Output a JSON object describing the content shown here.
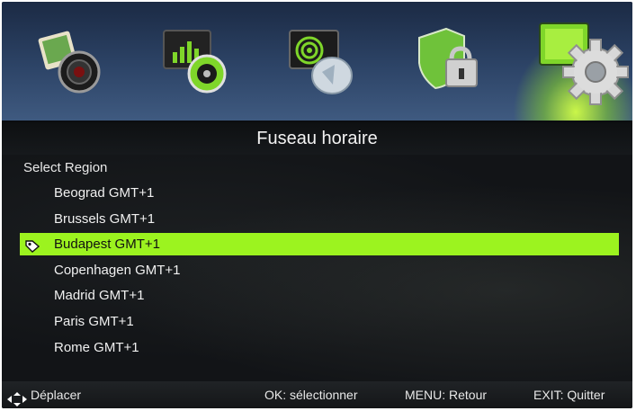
{
  "header": {
    "icons": [
      {
        "name": "picture-camera-icon"
      },
      {
        "name": "media-player-icon"
      },
      {
        "name": "satellite-dish-icon"
      },
      {
        "name": "security-lock-icon"
      },
      {
        "name": "settings-gear-icon"
      }
    ],
    "active_icon": "settings-gear-icon",
    "accent_color": "#9cf31f"
  },
  "title": "Fuseau horaire",
  "region_label": "Select Region",
  "regions": [
    {
      "label": "Beograd GMT+1",
      "selected": false
    },
    {
      "label": "Brussels GMT+1",
      "selected": false
    },
    {
      "label": "Budapest GMT+1",
      "selected": true
    },
    {
      "label": "Copenhagen GMT+1",
      "selected": false
    },
    {
      "label": "Madrid GMT+1",
      "selected": false
    },
    {
      "label": "Paris GMT+1",
      "selected": false
    },
    {
      "label": "Rome GMT+1",
      "selected": false
    }
  ],
  "footer": {
    "move_label": "Déplacer",
    "ok_label": "OK: sélectionner",
    "menu_label": "MENU: Retour",
    "exit_label": "EXIT: Quitter"
  }
}
